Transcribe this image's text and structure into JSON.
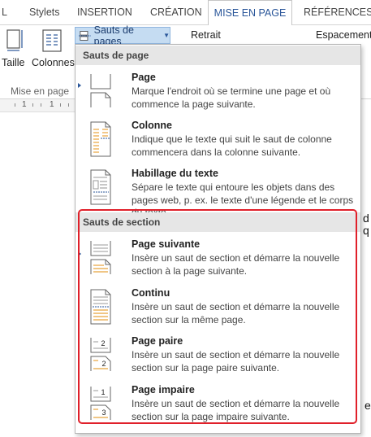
{
  "tabs": [
    {
      "label": "L",
      "active": false
    },
    {
      "label": "Stylets",
      "active": false
    },
    {
      "label": "INSERTION",
      "active": false
    },
    {
      "label": "CRÉATION",
      "active": false
    },
    {
      "label": "MISE EN PAGE",
      "active": true
    },
    {
      "label": "RÉFÉRENCES",
      "active": false
    }
  ],
  "ribbon": {
    "taille_label": "Taille",
    "colonnes_label": "Colonnes",
    "group_label": "Mise en page",
    "breaks_label": "Sauts de pages",
    "retrait_label": "Retrait",
    "espacement_label": "Espacement"
  },
  "ruler": {
    "marks": [
      "1",
      "1"
    ]
  },
  "doc_edge": {
    "line1": "d",
    "line2": "q",
    "line3": "e"
  },
  "menu": {
    "page_breaks_header": "Sauts de page",
    "section_breaks_header": "Sauts de section",
    "items": [
      {
        "title": "Page",
        "description": "Marque l'endroit où se termine une page et où commence la page suivante.",
        "icon": "page-break-icon"
      },
      {
        "title": "Colonne",
        "description": "Indique que le texte qui suit le saut de colonne commencera dans la colonne suivante.",
        "icon": "column-break-icon"
      },
      {
        "title": "Habillage du texte",
        "description": "Sépare le texte qui entoure les objets dans des pages web, p. ex. le texte d'une légende et le corps du texte.",
        "icon": "text-wrapping-break-icon"
      },
      {
        "title": "Page suivante",
        "description": "Insère un saut de section et démarre la nouvelle section à la page suivante.",
        "icon": "next-page-section-icon"
      },
      {
        "title": "Continu",
        "description": "Insère un saut de section et démarre la nouvelle section sur la même page.",
        "icon": "continuous-section-icon"
      },
      {
        "title": "Page paire",
        "description": "Insère un saut de section et démarre la nouvelle section sur la page paire suivante.",
        "icon": "even-page-section-icon",
        "badge": "2"
      },
      {
        "title": "Page impaire",
        "description": "Insère un saut de section et démarre la nouvelle section sur la page impaire suivante.",
        "icon": "odd-page-section-icon",
        "badge": "3"
      }
    ],
    "even_top_number": "2",
    "odd_top_number": "1"
  },
  "colors": {
    "accent": "#2b579a",
    "highlight": "#e0202a",
    "section_line": "#e8a33c"
  }
}
